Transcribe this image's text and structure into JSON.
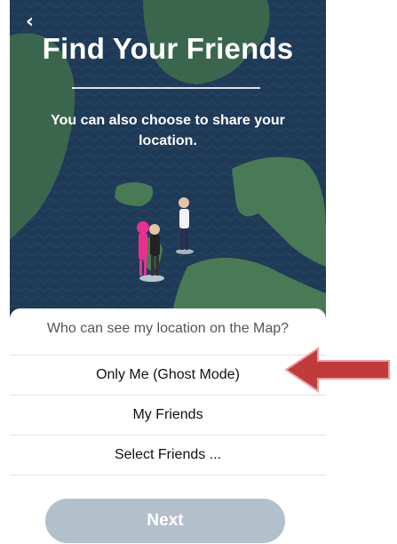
{
  "header": {
    "back_glyph": "‹",
    "title": "Find Your Friends",
    "subtitle": "You can also choose to share your location."
  },
  "sheet": {
    "question": "Who can see my location on the Map?",
    "options": [
      {
        "label": "Only Me (Ghost Mode)"
      },
      {
        "label": "My Friends"
      },
      {
        "label": "Select Friends ..."
      }
    ],
    "next_label": "Next"
  },
  "colors": {
    "ocean": "#1f3a56",
    "land": "#3e6b4c",
    "next_button": "#b4bfcc",
    "arrow": "#c23b3b"
  }
}
